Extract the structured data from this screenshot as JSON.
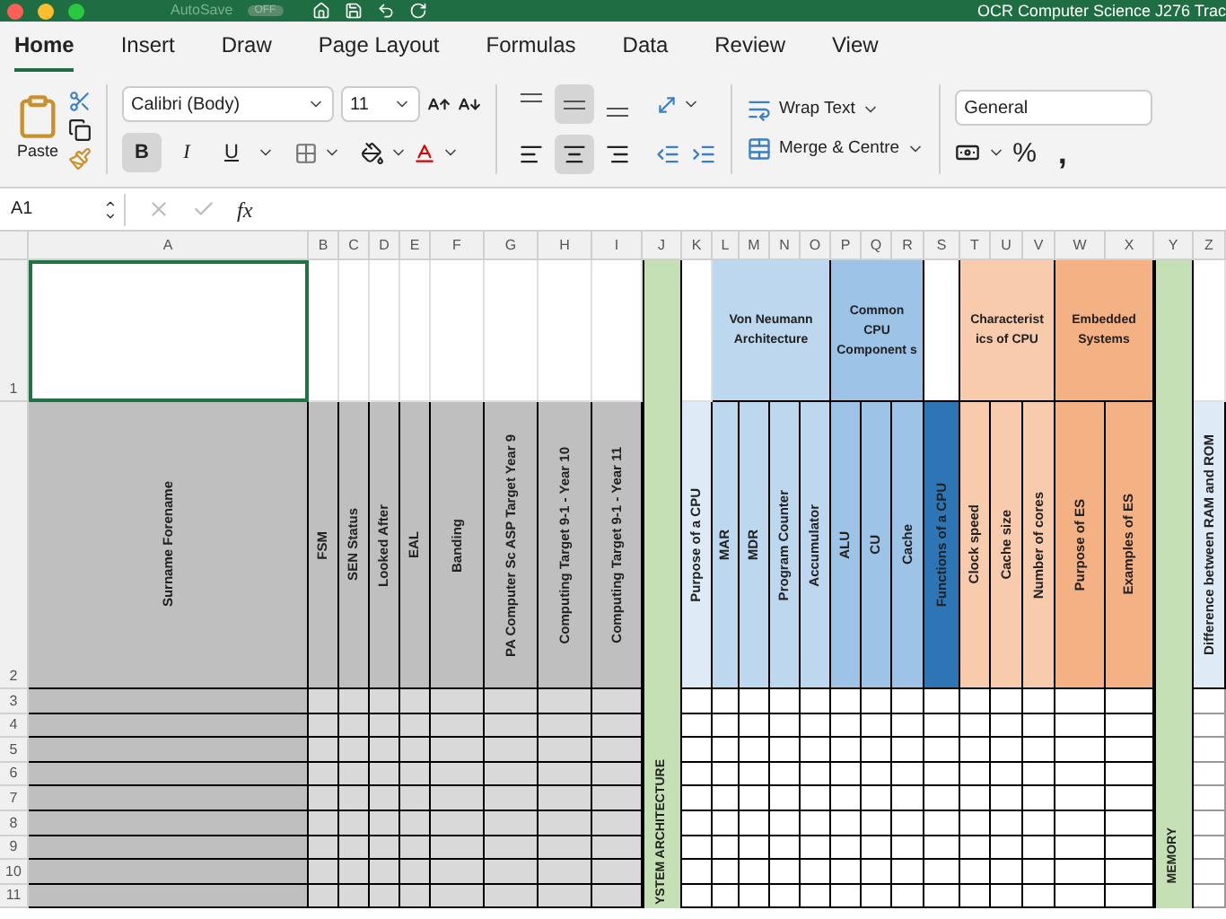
{
  "title_bar": {
    "autosave_label": "AutoSave",
    "autosave": {
      "on": false,
      "label": "OFF"
    },
    "document_title": "OCR Computer Science J276 Trac"
  },
  "tabs": [
    {
      "label": "Home",
      "selected": true
    },
    {
      "label": "Insert",
      "selected": false
    },
    {
      "label": "Draw",
      "selected": false
    },
    {
      "label": "Page Layout",
      "selected": false
    },
    {
      "label": "Formulas",
      "selected": false
    },
    {
      "label": "Data",
      "selected": false
    },
    {
      "label": "Review",
      "selected": false
    },
    {
      "label": "View",
      "selected": false
    }
  ],
  "ribbon": {
    "paste_label": "Paste",
    "font": "Calibri (Body)",
    "font_size": "11",
    "styles": [
      {
        "label": "B",
        "selected": true
      },
      {
        "label": "I",
        "selected": false
      },
      {
        "label": "U",
        "selected": false
      }
    ],
    "vertical_align": [
      {
        "selected": false
      },
      {
        "selected": true
      },
      {
        "selected": false
      }
    ],
    "horizontal_align": [
      {
        "selected": false
      },
      {
        "selected": true
      },
      {
        "selected": false
      }
    ],
    "wrap_text": "Wrap Text",
    "merge": "Merge & Centre",
    "number_format": "General",
    "percent": "%",
    "comma": ","
  },
  "formula_bar": {
    "name_box": "A1",
    "fx": "fx"
  },
  "sheet": {
    "columns": [
      "A",
      "B",
      "C",
      "D",
      "E",
      "F",
      "G",
      "H",
      "I",
      "J",
      "K",
      "L",
      "M",
      "N",
      "O",
      "P",
      "Q",
      "R",
      "S",
      "T",
      "U",
      "V",
      "W",
      "X",
      "Y",
      "Z"
    ],
    "rows": [
      "1",
      "2",
      "3",
      "4",
      "5",
      "6",
      "7",
      "8",
      "9",
      "10",
      "11"
    ],
    "a1": {
      "selected": true
    },
    "group_headers": [
      {
        "text": "Von Neumann Architecture",
        "color": "#bdd7ee"
      },
      {
        "text": "Common CPU Component s",
        "color": "#9dc3e6"
      },
      {
        "text": "Characterist ics of CPU",
        "color": "#f8cbad"
      },
      {
        "text": "Embedded Systems",
        "color": "#f4b183"
      }
    ],
    "field_headers": [
      {
        "text": "Surname Forename",
        "color": "#bfbfbf"
      },
      {
        "text": "FSM",
        "color": "#bfbfbf"
      },
      {
        "text": "SEN Status",
        "color": "#bfbfbf"
      },
      {
        "text": "Looked After",
        "color": "#bfbfbf"
      },
      {
        "text": "EAL",
        "color": "#bfbfbf"
      },
      {
        "text": "Banding",
        "color": "#bfbfbf"
      },
      {
        "text": "PA Computer Sc ASP Target Year 9",
        "color": "#bfbfbf"
      },
      {
        "text": "Computing Target 9-1 - Year 10",
        "color": "#bfbfbf"
      },
      {
        "text": "Computing Target 9-1  - Year 11",
        "color": "#bfbfbf"
      },
      {
        "text": "Purpose of a CPU",
        "color": "#deebf7"
      },
      {
        "text": "MAR",
        "color": "#bdd7ee"
      },
      {
        "text": "MDR",
        "color": "#bdd7ee"
      },
      {
        "text": "Program Counter",
        "color": "#bdd7ee"
      },
      {
        "text": "Accumulator",
        "color": "#bdd7ee"
      },
      {
        "text": "ALU",
        "color": "#9dc3e6"
      },
      {
        "text": "CU",
        "color": "#9dc3e6"
      },
      {
        "text": "Cache",
        "color": "#9dc3e6"
      },
      {
        "text": "Functions of a CPU",
        "color": "#2e75b6"
      },
      {
        "text": "Clock speed",
        "color": "#f8cbad"
      },
      {
        "text": "Cache size",
        "color": "#f8cbad"
      },
      {
        "text": "Number of cores",
        "color": "#f8cbad"
      },
      {
        "text": "Purpose of ES",
        "color": "#f4b183"
      },
      {
        "text": "Examples of ES",
        "color": "#f4b183"
      },
      {
        "text": "Difference between RAM and ROM",
        "color": "#deebf7"
      }
    ],
    "section_labels": [
      {
        "text": "YSTEM ARCHITECTURE",
        "color": "#c5e0b4"
      },
      {
        "text": "MEMORY",
        "color": "#c5e0b4"
      }
    ]
  }
}
